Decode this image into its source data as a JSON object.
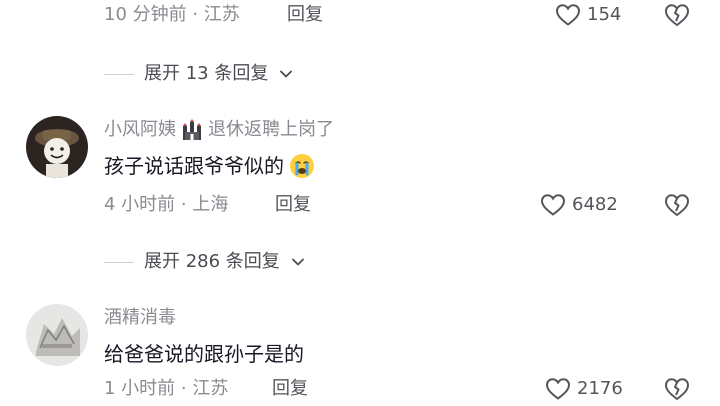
{
  "comments": [
    {
      "meta": "10 分钟前 · 江苏",
      "reply": "回复",
      "likes": "154"
    },
    {
      "username": "小风阿姨",
      "badge_icon": "castle-badge-icon",
      "badge_text": "退休返聘上岗了",
      "text": "孩子说话跟爷爷似的",
      "emoji_icon": "crying-face-icon",
      "meta": "4 小时前 · 上海",
      "reply": "回复",
      "likes": "6482"
    },
    {
      "username": "酒精消毒",
      "text": "给爸爸说的跟孙子是的",
      "meta": "1 小时前 · 江苏",
      "reply": "回复",
      "likes": "2176"
    }
  ],
  "expanders": [
    {
      "label": "展开 13 条回复"
    },
    {
      "label": "展开 286 条回复"
    }
  ],
  "colors": {
    "text": "#161823",
    "meta": "#8a8b91",
    "background": "#ffffff"
  }
}
